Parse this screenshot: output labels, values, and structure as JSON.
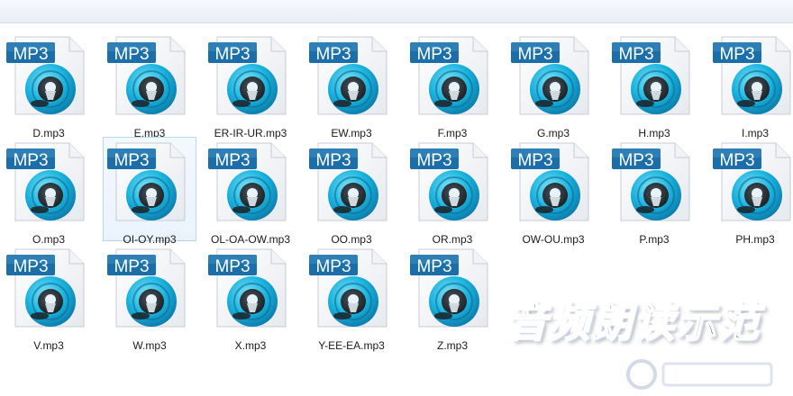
{
  "icon_text": "MP3",
  "banner_text": "音频朗读示范",
  "colors": {
    "badge": "#1b6ea7",
    "disc_ring": "#1ab3de",
    "disc_center": "#1b2226"
  },
  "files": [
    {
      "name": "D.mp3"
    },
    {
      "name": "E.mp3"
    },
    {
      "name": "ER-IR-UR.mp3"
    },
    {
      "name": "EW.mp3"
    },
    {
      "name": "F.mp3"
    },
    {
      "name": "G.mp3"
    },
    {
      "name": "H.mp3"
    },
    {
      "name": "I.mp3"
    },
    {
      "name": "O.mp3"
    },
    {
      "name": "OI-OY.mp3",
      "selected": true
    },
    {
      "name": "OL-OA-OW.mp3"
    },
    {
      "name": "OO.mp3"
    },
    {
      "name": "OR.mp3"
    },
    {
      "name": "OW-OU.mp3"
    },
    {
      "name": "P.mp3"
    },
    {
      "name": "PH.mp3"
    },
    {
      "name": "V.mp3"
    },
    {
      "name": "W.mp3"
    },
    {
      "name": "X.mp3"
    },
    {
      "name": "Y-EE-EA.mp3"
    },
    {
      "name": "Z.mp3"
    }
  ]
}
